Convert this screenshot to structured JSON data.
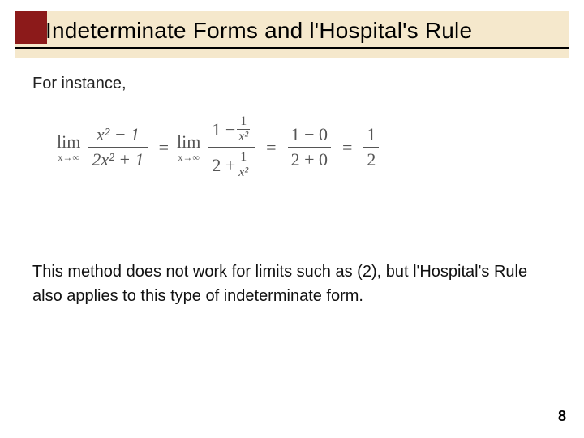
{
  "title": "Indeterminate Forms and l'Hospital's Rule",
  "intro": "For instance,",
  "equation": {
    "lim_label": "lim",
    "lim_sub": "x→∞",
    "lhs_num": "x² − 1",
    "lhs_den": "2x² + 1",
    "big_num_lead": "1 − ",
    "big_den_lead": "2 + ",
    "small_frac_num": "1",
    "small_frac_den": "x²",
    "plug_num": "1 − 0",
    "plug_den": "2 + 0",
    "result_num": "1",
    "result_den": "2",
    "eq": "="
  },
  "explain": "This method does not work for limits such as (2), but l'Hospital's Rule also applies to this type of indeterminate form.",
  "page": "8"
}
